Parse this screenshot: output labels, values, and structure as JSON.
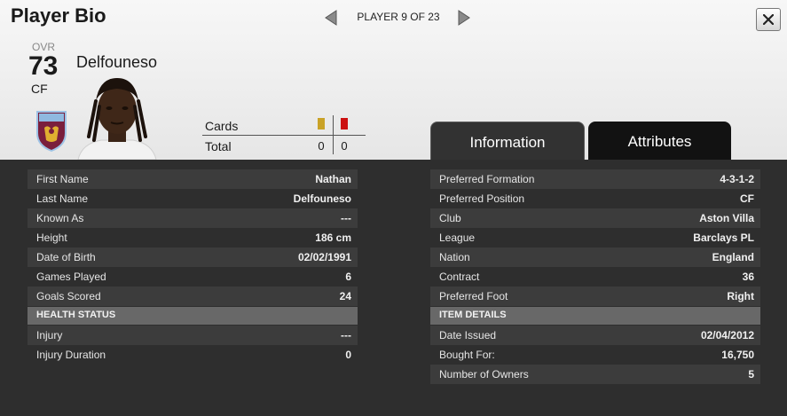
{
  "header": {
    "title": "Player Bio",
    "pager_text": "PLAYER 9 OF 23"
  },
  "player": {
    "ovr_label": "OVR",
    "rating": "73",
    "position": "CF",
    "name": "Delfouneso",
    "club_crest": "aston-villa-crest"
  },
  "cards": {
    "header_label": "Cards",
    "total_label": "Total",
    "yellow": "0",
    "red": "0",
    "yellow_color": "#c9a227",
    "red_color": "#cc1111"
  },
  "tabs": {
    "information": "Information",
    "attributes": "Attributes",
    "active": "Information"
  },
  "bio": {
    "rows": [
      {
        "label": "First Name",
        "value": "Nathan"
      },
      {
        "label": "Last Name",
        "value": "Delfouneso"
      },
      {
        "label": "Known As",
        "value": "---"
      },
      {
        "label": "Height",
        "value": "186 cm"
      },
      {
        "label": "Date of Birth",
        "value": "02/02/1991"
      },
      {
        "label": "Games Played",
        "value": "6"
      },
      {
        "label": "Goals Scored",
        "value": "24"
      }
    ],
    "health_header": "HEALTH STATUS",
    "health_rows": [
      {
        "label": "Injury",
        "value": "---"
      },
      {
        "label": "Injury Duration",
        "value": "0"
      }
    ]
  },
  "info": {
    "rows": [
      {
        "label": "Preferred Formation",
        "value": "4-3-1-2"
      },
      {
        "label": "Preferred Position",
        "value": "CF"
      },
      {
        "label": "Club",
        "value": "Aston Villa"
      },
      {
        "label": "League",
        "value": "Barclays PL"
      },
      {
        "label": "Nation",
        "value": "England"
      },
      {
        "label": "Contract",
        "value": "36"
      },
      {
        "label": "Preferred Foot",
        "value": "Right"
      }
    ],
    "item_header": "ITEM DETAILS",
    "item_rows": [
      {
        "label": "Date Issued",
        "value": "02/04/2012"
      },
      {
        "label": "Bought For:",
        "value": "16,750"
      },
      {
        "label": "Number of Owners",
        "value": "5"
      }
    ]
  }
}
